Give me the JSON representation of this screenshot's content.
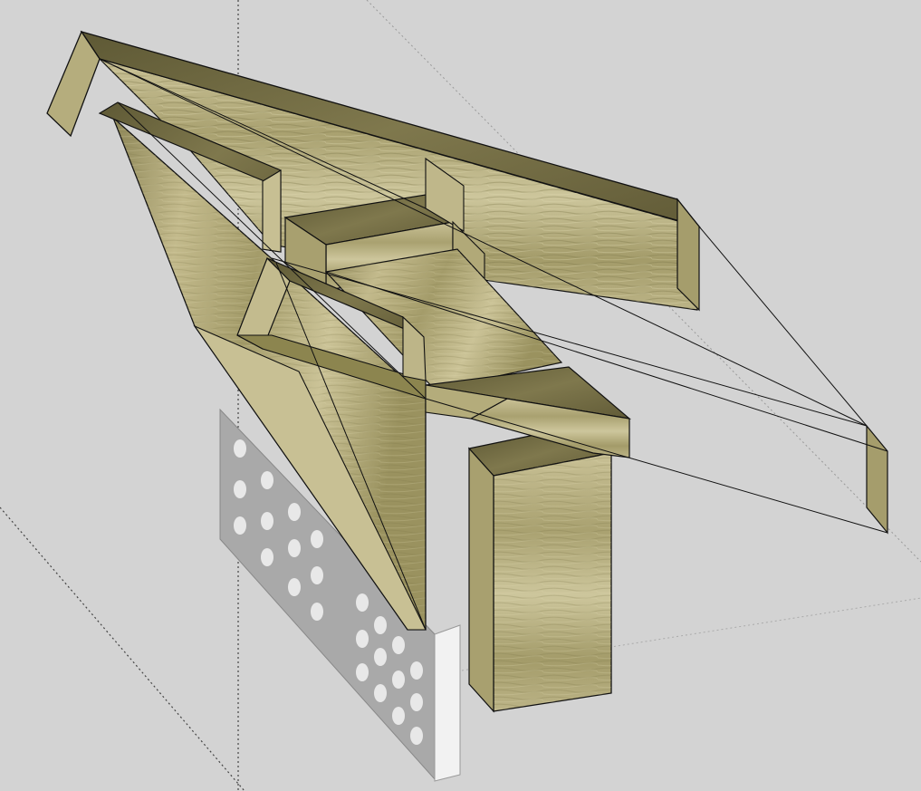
{
  "app": {
    "viewport": "3d-model-viewport"
  },
  "scene": {
    "background_color": "#d3d3d3",
    "wood_color": "#b3aa7a",
    "wood_dark": "#6e6842",
    "wood_light": "#cfc79a",
    "edge_color": "#111111",
    "block_color": "#aaaaaa",
    "block_face_color": "#c8c8c8",
    "axis_color": "#555555"
  }
}
